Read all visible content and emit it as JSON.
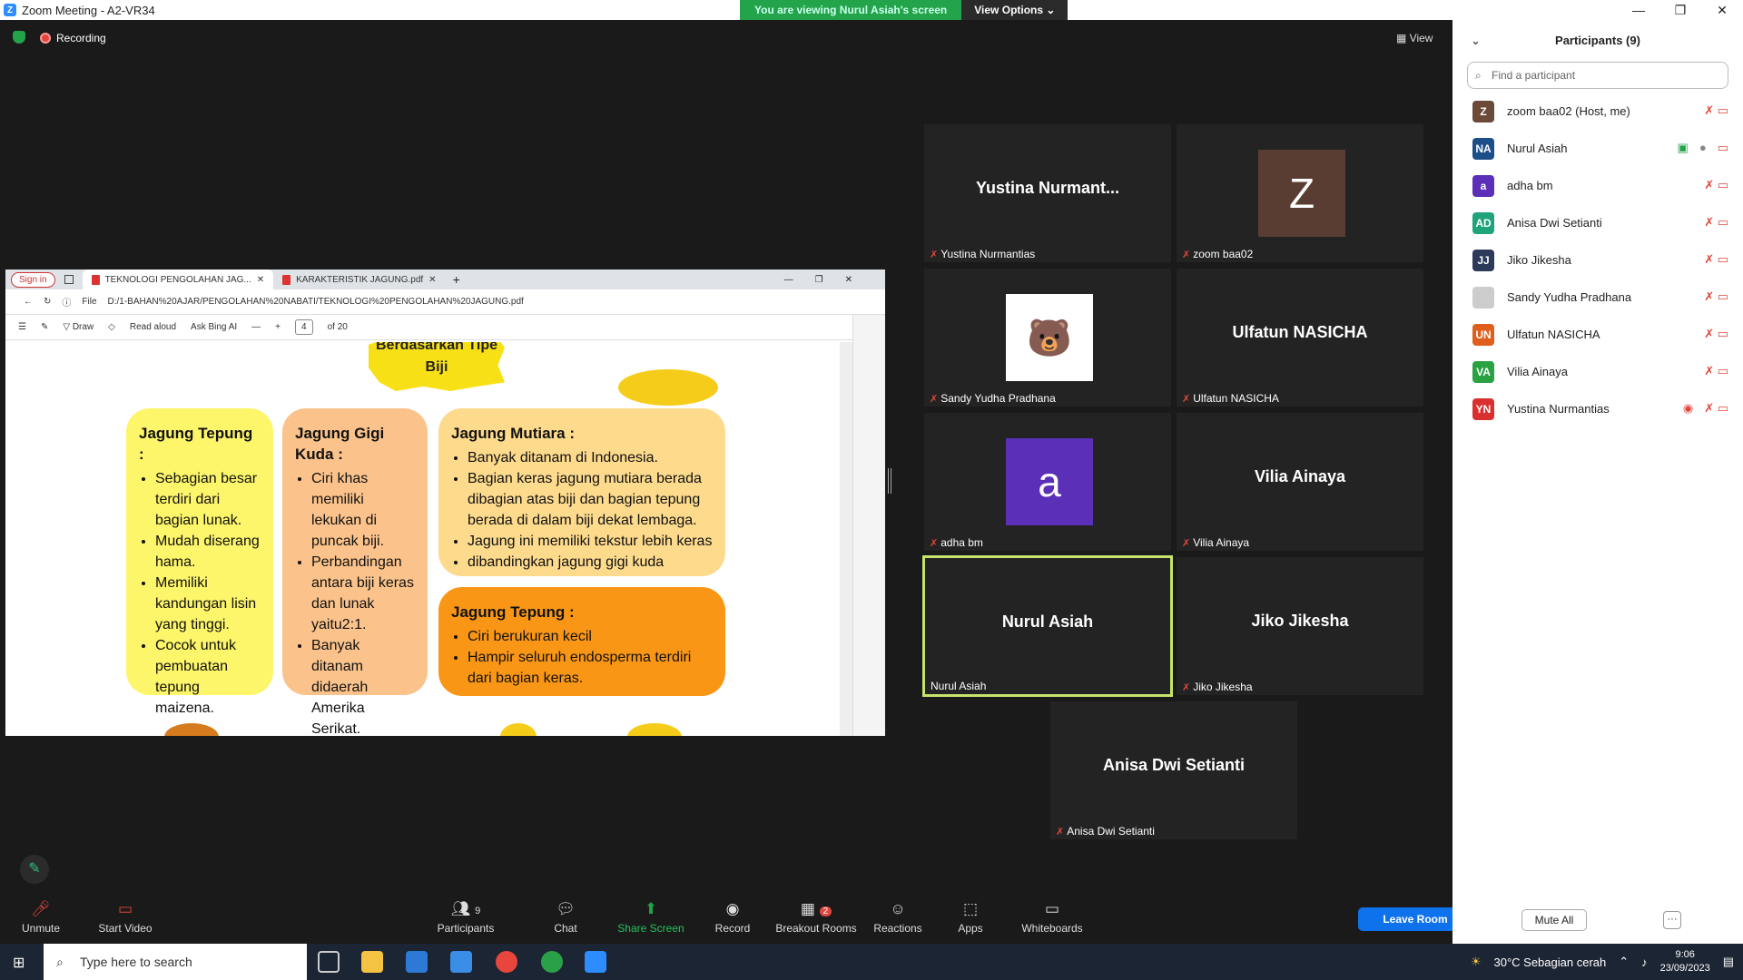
{
  "window": {
    "title": "Zoom Meeting - A2-VR34",
    "controls": [
      "—",
      "❐",
      "✕"
    ]
  },
  "banner": {
    "viewing": "You are viewing Nurul Asiah's screen",
    "options": "View Options"
  },
  "status": {
    "recording": "Recording",
    "view": "View"
  },
  "browser": {
    "sign_in": "Sign in",
    "tabs": [
      "TEKNOLOGI PENGOLAHAN JAG...",
      "KARAKTERISTIK JAGUNG.pdf"
    ],
    "file_label": "File",
    "url": "D:/1-BAHAN%20AJAR/PENGOLAHAN%20NABATI/TEKNOLOGI%20PENGOLAHAN%20JAGUNG.pdf",
    "draw": "Draw",
    "read_aloud": "Read aloud",
    "ask_bing": "Ask Bing AI",
    "page": "4",
    "of_pages": "of 20"
  },
  "slide": {
    "star_text": "Berdasarkan Tipe Biji",
    "box1": {
      "title": "Jagung Tepung :",
      "items": [
        "Sebagian besar terdiri dari bagian lunak.",
        "Mudah diserang hama.",
        "Memiliki kandungan lisin yang tinggi.",
        "Cocok untuk pembuatan tepung maizena."
      ]
    },
    "box2": {
      "title": "Jagung Gigi Kuda :",
      "items": [
        "Ciri khas memiliki lekukan di puncak biji.",
        "Perbandingan antara biji keras dan lunak yaitu2:1.",
        "Banyak ditanam didaerah Amerika Serikat."
      ]
    },
    "box3": {
      "title": "Jagung Mutiara :",
      "items": [
        "Banyak ditanam di Indonesia.",
        "Bagian keras jagung mutiara berada dibagian atas biji dan bagian tepung berada di dalam biji dekat lembaga.",
        "Jagung ini memiliki tekstur lebih keras",
        "dibandingkan jagung gigi kuda"
      ]
    },
    "box4": {
      "title": "Jagung Tepung :",
      "items": [
        "Ciri berukuran kecil",
        "Hampir seluruh endosperma terdiri dari bagian keras."
      ]
    }
  },
  "tiles": [
    {
      "name": "Yustina  Nurmant...",
      "label": "Yustina Nurmantias",
      "muted": true
    },
    {
      "name": "Z",
      "label": "zoom baa02",
      "muted": true,
      "avatar": "#5a3d32"
    },
    {
      "name": "",
      "label": "Sandy Yudha Pradhana",
      "muted": true
    },
    {
      "name": "Ulfatun NASICHA",
      "label": "Ulfatun NASICHA",
      "muted": true
    },
    {
      "name": "a",
      "label": "adha bm",
      "muted": true,
      "avatar": "#5b2fb8"
    },
    {
      "name": "Vilia Ainaya",
      "label": "Vilia Ainaya",
      "muted": true
    },
    {
      "name": "Nurul Asiah",
      "label": "Nurul Asiah",
      "muted": false
    },
    {
      "name": "Jiko Jikesha",
      "label": "Jiko Jikesha",
      "muted": true
    },
    {
      "name": "Anisa Dwi Setianti",
      "label": "Anisa Dwi Setianti",
      "muted": true
    }
  ],
  "toolbar": {
    "unmute": "Unmute",
    "start_video": "Start Video",
    "participants": "Participants",
    "participants_count": "9",
    "chat": "Chat",
    "share": "Share Screen",
    "record": "Record",
    "breakout": "Breakout Rooms",
    "breakout_badge": "2",
    "reactions": "Reactions",
    "apps": "Apps",
    "whiteboards": "Whiteboards",
    "leave": "Leave Room"
  },
  "panel": {
    "title": "Participants (9)",
    "search_placeholder": "Find a participant",
    "mute_all": "Mute All",
    "more": "···",
    "people": [
      {
        "initials": "Z",
        "name": "zoom baa02 (Host, me)",
        "color": "#6b4a3a"
      },
      {
        "initials": "NA",
        "name": "Nurul Asiah",
        "color": "#1c4f8a"
      },
      {
        "initials": "a",
        "name": "adha bm",
        "color": "#5b2fb8"
      },
      {
        "initials": "AD",
        "name": "Anisa Dwi Setianti",
        "color": "#1fa37a"
      },
      {
        "initials": "JJ",
        "name": "Jiko Jikesha",
        "color": "#2e3a5a"
      },
      {
        "initials": "",
        "name": "Sandy Yudha Pradhana",
        "color": "#cccccc"
      },
      {
        "initials": "UN",
        "name": "Ulfatun NASICHA",
        "color": "#e05e1c"
      },
      {
        "initials": "VA",
        "name": "Vilia Ainaya",
        "color": "#2aa142"
      },
      {
        "initials": "YN",
        "name": "Yustina Nurmantias",
        "color": "#d9302f"
      }
    ]
  },
  "taskbar": {
    "search": "Type here to search",
    "weather": "30°C  Sebagian cerah",
    "time": "9:06",
    "date": "23/09/2023"
  }
}
